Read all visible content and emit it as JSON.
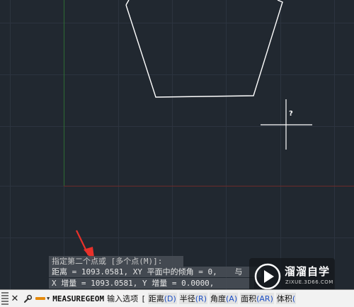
{
  "cursor": {
    "tooltip": "?"
  },
  "history": {
    "line1": "指定第二个点或 [多个点(M)]:",
    "line2": "距离 = 1093.0581, XY 平面中的倾角 = 0,",
    "line2_tail": "与",
    "line3": "X 增量 = 1093.0581,   Y 增量 = 0.0000,"
  },
  "watermark": {
    "title": "溜溜自学",
    "url": "ZIXUE.3D66.COM"
  },
  "command_bar": {
    "close_icon": "✕",
    "settings_icon": "wrench-icon",
    "command_name": "MEASUREGEOM",
    "prompt": "输入选项",
    "bracket": "[",
    "options": [
      {
        "label": "距离",
        "key": "(D)"
      },
      {
        "label": "半径",
        "key": "(R)"
      },
      {
        "label": "角度",
        "key": "(A)"
      },
      {
        "label": "面积",
        "key": "(AR)"
      },
      {
        "label": "体积",
        "key": "("
      }
    ]
  },
  "colors": {
    "background": "#212830",
    "grid": "#2f3742",
    "y_axis": "#2d6b33",
    "x_axis": "#6b2a2a",
    "polygon": "#ffffff",
    "annotation_arrow": "#e8312a",
    "option_hotkey": "#1d4fc4"
  }
}
